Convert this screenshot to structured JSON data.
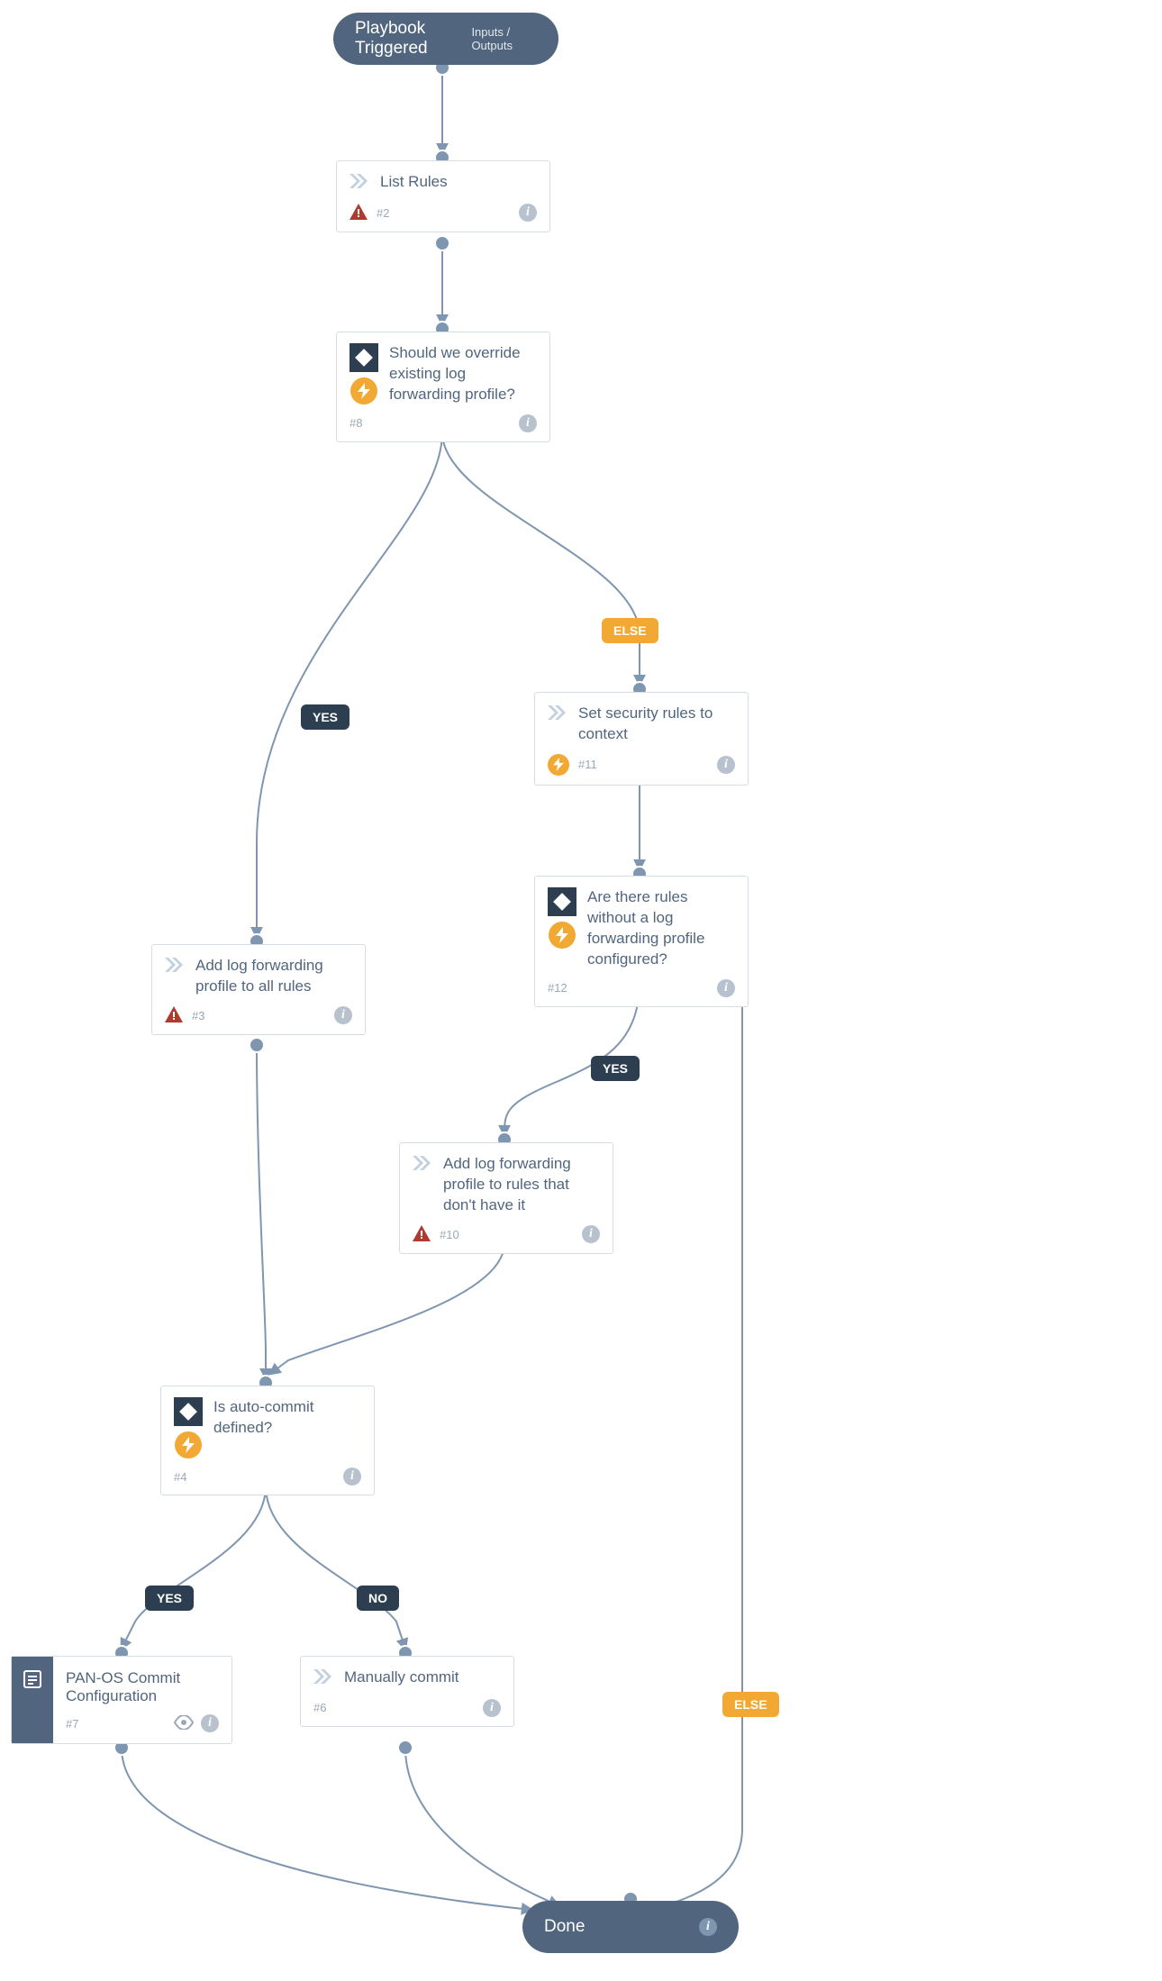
{
  "start": {
    "title": "Playbook Triggered",
    "subtitle": "Inputs / Outputs"
  },
  "end": {
    "title": "Done"
  },
  "labels": {
    "yes": "YES",
    "no": "NO",
    "else": "ELSE"
  },
  "nodes": {
    "n2": {
      "title": "List Rules",
      "ref": "#2",
      "kind": "task-warn"
    },
    "n8": {
      "title": "Should we override existing log forwarding profile?",
      "ref": "#8",
      "kind": "condition"
    },
    "n11": {
      "title": "Set security rules to context",
      "ref": "#11",
      "kind": "task-bolt"
    },
    "n12": {
      "title": "Are there rules without a log forwarding profile configured?",
      "ref": "#12",
      "kind": "condition"
    },
    "n3": {
      "title": "Add log forwarding profile to all rules",
      "ref": "#3",
      "kind": "task-warn"
    },
    "n10": {
      "title": "Add log forwarding profile to rules that don't have it",
      "ref": "#10",
      "kind": "task-warn"
    },
    "n4": {
      "title": "Is auto-commit defined?",
      "ref": "#4",
      "kind": "condition"
    },
    "n7": {
      "title": "PAN-OS Commit Configuration",
      "ref": "#7",
      "kind": "script"
    },
    "n6": {
      "title": "Manually commit",
      "ref": "#6",
      "kind": "task"
    }
  }
}
